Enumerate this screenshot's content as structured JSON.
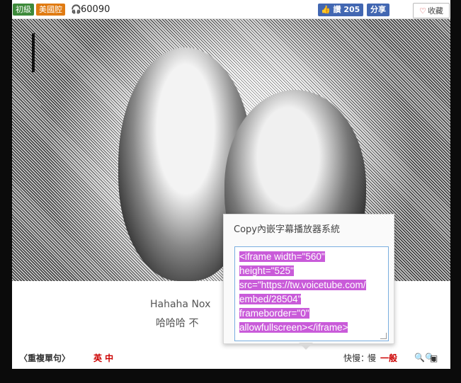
{
  "header": {
    "level_badge": "初級",
    "accent_badge": "美國腔",
    "views_icon": "headphones-icon",
    "views_count": "60090",
    "like_label": "讚 205",
    "share_label": "分享",
    "favorite_label": "收藏"
  },
  "subtitles": {
    "english": "Hahaha  Nox",
    "chinese": "哈哈哈 不"
  },
  "controls": {
    "repeat_label": "〈重複單句〉",
    "language_label": "英 中",
    "speed_label": "快慢：",
    "speed_slow": "慢",
    "speed_normal": "一般",
    "zoom_icons": "🔍🔍",
    "tv_icon": "▣"
  },
  "embed_popup": {
    "title": "Copy內嵌字幕播放器系統",
    "code_lines": [
      "<iframe width=\"560\"",
      "height=\"525\"",
      "src=\"https://tw.voicetube.com/",
      "embed/28504\"",
      "frameborder=\"0\"",
      "allowfullscreen></iframe>"
    ]
  },
  "colors": {
    "level_badge": "#3d8a3a",
    "accent_badge": "#e07b12",
    "facebook": "#4267b2",
    "highlight": "#c95bd9",
    "red_text": "#cc0000"
  }
}
